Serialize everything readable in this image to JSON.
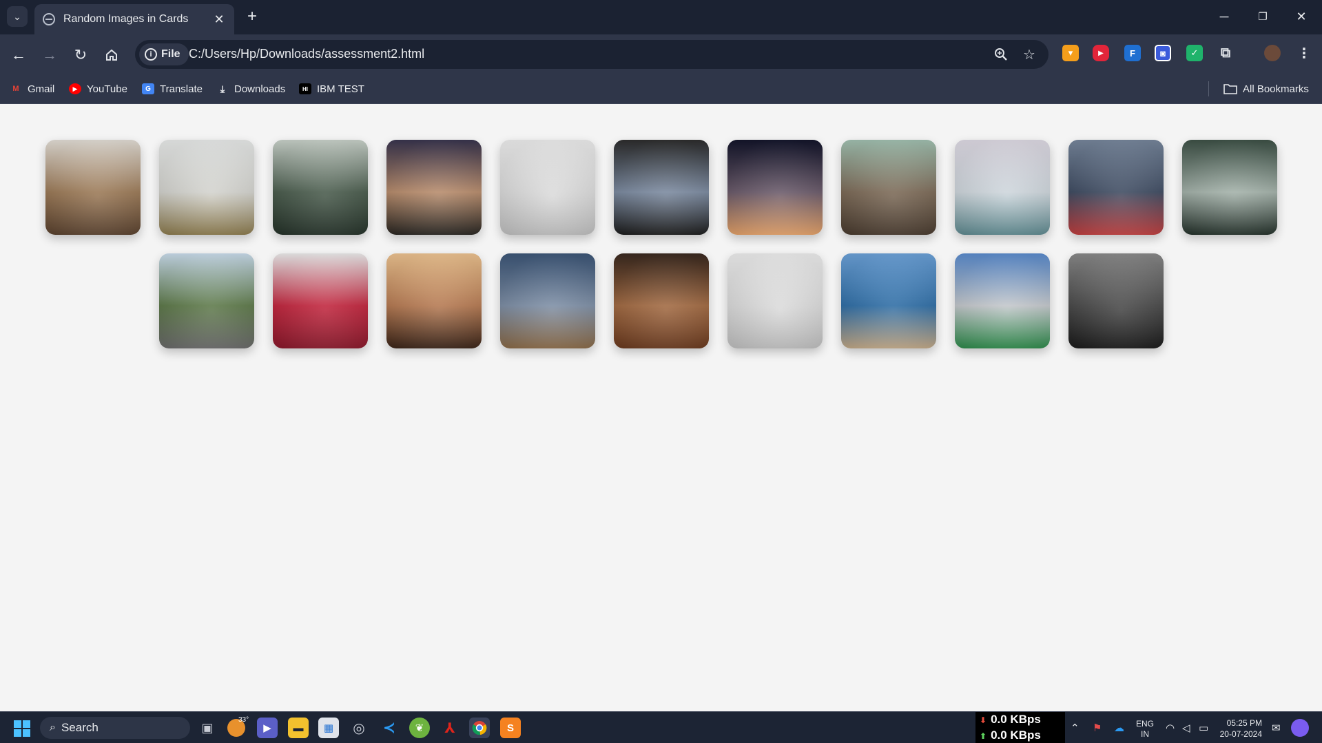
{
  "browser": {
    "tab_title": "Random Images in Cards",
    "tab_close": "✕",
    "new_tab": "+",
    "file_chip": "File",
    "url": "C:/Users/Hp/Downloads/assessment2.html"
  },
  "window_controls": {
    "minimize": "─",
    "restore": "❐",
    "close": "✕"
  },
  "bookmarks": [
    {
      "label": "Gmail",
      "icon": "gmail-icon"
    },
    {
      "label": "YouTube",
      "icon": "youtube-icon"
    },
    {
      "label": "Translate",
      "icon": "translate-icon"
    },
    {
      "label": "Downloads",
      "icon": "download-icon"
    },
    {
      "label": "IBM TEST",
      "icon": "ibm-icon"
    }
  ],
  "all_bookmarks": "All Bookmarks",
  "cards": [
    {
      "subject": "walrus",
      "colors": [
        "#e9e4dc",
        "#9c7a57",
        "#5b4330"
      ]
    },
    {
      "subject": "grass-dunes",
      "colors": [
        "#eef0ef",
        "#d4d4cf",
        "#8c7b4e"
      ]
    },
    {
      "subject": "forest",
      "colors": [
        "#cfd8d0",
        "#4a5c4d",
        "#26332a"
      ]
    },
    {
      "subject": "mountain-sunset",
      "colors": [
        "#3a3650",
        "#b88c6c",
        "#2a2723"
      ]
    },
    {
      "subject": "laptop",
      "colors": [
        "#f3f3f3",
        "#dcdcdc",
        "#bfbfbf"
      ]
    },
    {
      "subject": "woman-reading",
      "colors": [
        "#2e2e2e",
        "#7b8aa0",
        "#1d1d1d"
      ]
    },
    {
      "subject": "dusk-sky",
      "colors": [
        "#14162c",
        "#6a5a6a",
        "#e4a26a"
      ]
    },
    {
      "subject": "volcano",
      "colors": [
        "#a6c6b6",
        "#7c6a57",
        "#4a3c30"
      ]
    },
    {
      "subject": "misty-lake",
      "colors": [
        "#e4e0ea",
        "#cfd7dd",
        "#5f8a90"
      ]
    },
    {
      "subject": "game-controller",
      "colors": [
        "#7a8aa0",
        "#3f4c62",
        "#c04040"
      ]
    },
    {
      "subject": "fog-trees",
      "colors": [
        "#3f5348",
        "#a4b2aa",
        "#25322b"
      ]
    },
    {
      "subject": "mountain-road",
      "colors": [
        "#cfe2f2",
        "#5e7a4a",
        "#6a6a6a"
      ]
    },
    {
      "subject": "raspberries",
      "colors": [
        "#f2f2f2",
        "#c2263e",
        "#8a1a2c"
      ]
    },
    {
      "subject": "sunset-girl",
      "colors": [
        "#f3c894",
        "#b67a52",
        "#3b2519"
      ]
    },
    {
      "subject": "country-road",
      "colors": [
        "#3e587a",
        "#7e8fa6",
        "#8a6a47"
      ]
    },
    {
      "subject": "coffee",
      "colors": [
        "#3b2a20",
        "#a26a42",
        "#6a3a1f"
      ]
    },
    {
      "subject": "laptop",
      "colors": [
        "#f3f3f3",
        "#dcdcdc",
        "#bfbfbf"
      ]
    },
    {
      "subject": "ocean-coast",
      "colors": [
        "#6fa6de",
        "#2f6ea6",
        "#c2a886"
      ]
    },
    {
      "subject": "stadium",
      "colors": [
        "#5d8fd2",
        "#c4c8cc",
        "#2d8a4a"
      ]
    },
    {
      "subject": "underwater-diver",
      "colors": [
        "#8d8d8d",
        "#4a4a4a",
        "#1c1c1c"
      ]
    }
  ],
  "taskbar": {
    "search": "Search",
    "weather": "33°",
    "net_down": "0.0 KBps",
    "net_up": "0.0 KBps",
    "lang_1": "ENG",
    "lang_2": "IN",
    "time": "05:25 PM",
    "date": "20-07-2024"
  }
}
